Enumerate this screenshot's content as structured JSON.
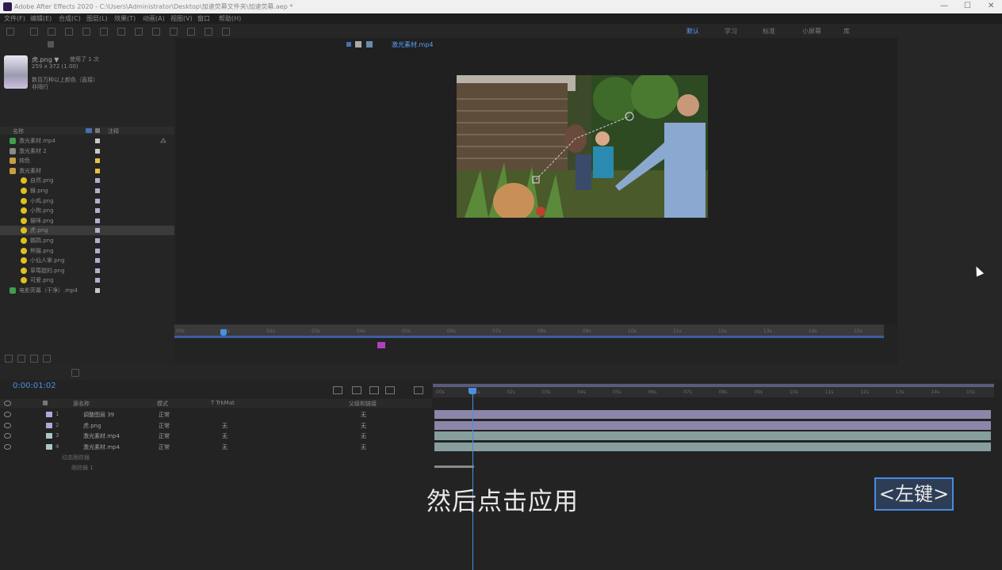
{
  "window": {
    "title": "Adobe After Effects 2020 - C:\\Users\\Administrator\\Desktop\\加速荧幕文件夹\\加速荧幕.aep *",
    "minimize": "—",
    "maximize": "☐",
    "close": "✕"
  },
  "menu": [
    "文件(F)",
    "编辑(E)",
    "合成(C)",
    "图层(L)",
    "效果(T)",
    "动画(A)",
    "视图(V)",
    "窗口",
    "帮助(H)"
  ],
  "workspaces": [
    "默认",
    "学习",
    "标准",
    "小屏幕",
    "库"
  ],
  "project": {
    "selected_name": "虎.png ▼",
    "used": "使用了 1 次",
    "dims": "259 x 372 (1.00)",
    "desc": "数百万种以上颜色（直接）",
    "desc2": "非隔行",
    "col_name": "名称",
    "col_comment": "注释",
    "items": [
      {
        "name": "激光素材.mp4",
        "type": "footage",
        "color": "#c8c8c8"
      },
      {
        "name": "激光素材 2",
        "type": "comp",
        "color": "#c8c8c8"
      },
      {
        "name": "纯色",
        "type": "folder",
        "color": "#e8c040"
      },
      {
        "name": "激光素材",
        "type": "folder",
        "color": "#e8c040"
      },
      {
        "name": "自然.png",
        "type": "image",
        "color": "#b0b0d0"
      },
      {
        "name": "猴.png",
        "type": "image",
        "color": "#b0b0d0"
      },
      {
        "name": "小鸡.png",
        "type": "image",
        "color": "#b0b0d0"
      },
      {
        "name": "小狗.png",
        "type": "image",
        "color": "#b0b0d0"
      },
      {
        "name": "猫咪.png",
        "type": "image",
        "color": "#b0b0d0"
      },
      {
        "name": "虎.png",
        "type": "image",
        "color": "#b0b0d0",
        "selected": true
      },
      {
        "name": "鹦鹉.png",
        "type": "image",
        "color": "#b0b0d0"
      },
      {
        "name": "熊猫.png",
        "type": "image",
        "color": "#b0b0d0"
      },
      {
        "name": "小仙人掌.png",
        "type": "image",
        "color": "#b0b0d0"
      },
      {
        "name": "草莓甜的.png",
        "type": "image",
        "color": "#b0b0d0"
      },
      {
        "name": "可爱.png",
        "type": "image",
        "color": "#b0b0d0"
      },
      {
        "name": "电影荧幕（干净）.mp4",
        "type": "footage",
        "color": "#c8c8c8"
      }
    ]
  },
  "viewer": {
    "tab": "激光素材.mp4"
  },
  "footage_ruler": {
    "ticks": [
      "00s",
      "01s",
      "02s",
      "03s",
      "04s",
      "05s",
      "06s",
      "07s",
      "08s",
      "09s",
      "10s",
      "11s",
      "12s",
      "13s",
      "14s",
      "15s"
    ]
  },
  "timeline": {
    "timecode": "0:00:01:02",
    "columns": {
      "source": "源名称",
      "mode": "模式",
      "trkmat": "T  TrkMat",
      "parent": "父级和链接"
    },
    "layers": [
      {
        "num": "1",
        "name": "调整图层 39",
        "mode": "正常",
        "trkmat": "",
        "parent": "无",
        "color": "#b0a8d8"
      },
      {
        "num": "2",
        "name": "虎.png",
        "mode": "正常",
        "trkmat": "无",
        "parent": "无",
        "color": "#b0a8d8"
      },
      {
        "num": "3",
        "name": "激光素材.mp4",
        "mode": "正常",
        "trkmat": "无",
        "parent": "无",
        "color": "#a8c8c8"
      },
      {
        "num": "4",
        "name": "激光素材.mp4",
        "mode": "正常",
        "trkmat": "无",
        "parent": "无",
        "color": "#a8c8c8"
      }
    ],
    "sub_rows": [
      "动态跟踪器",
      "跟踪器 1"
    ],
    "ruler_ticks": [
      "00s",
      "01s",
      "02s",
      "03s",
      "04s",
      "05s",
      "06s",
      "07s",
      "08s",
      "09s",
      "10s",
      "11s",
      "12s",
      "13s",
      "14s",
      "15s"
    ],
    "playhead_fraction": 0.07
  },
  "overlay": {
    "subtitle": "然后点击应用",
    "key_badge": "<左键>"
  }
}
